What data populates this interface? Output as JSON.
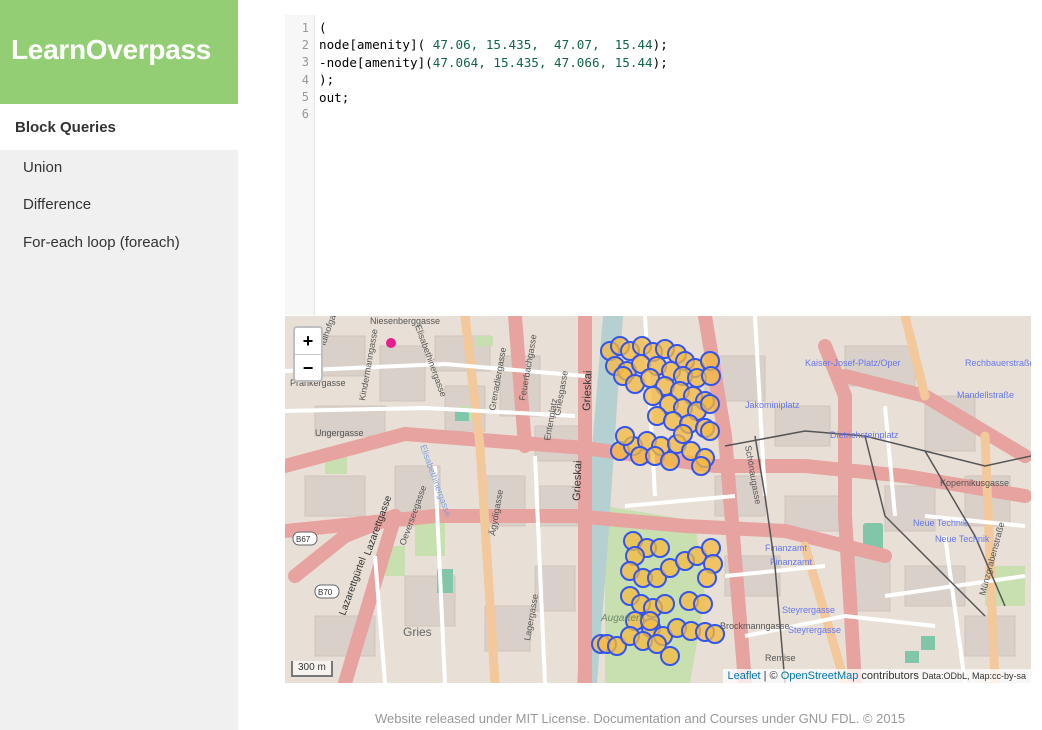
{
  "brand": {
    "title": "LearnOverpass"
  },
  "sidebar": {
    "section_title": "Block Queries",
    "items": [
      {
        "label": "Union"
      },
      {
        "label": "Difference"
      },
      {
        "label": "For-each loop (foreach)"
      }
    ]
  },
  "editor": {
    "line_numbers": [
      "1",
      "2",
      "3",
      "4",
      "5",
      "6"
    ],
    "lines": [
      {
        "a": "(",
        "n": "",
        "b": ""
      },
      {
        "a": "node[amenity](",
        "n": " 47.06, 15.435,  47.07,  15.44",
        "b": ");"
      },
      {
        "a": "-node[amenity](",
        "n": "47.064, 15.435, 47.066, 15.44",
        "b": ");"
      },
      {
        "a": ");",
        "n": "",
        "b": ""
      },
      {
        "a": "out;",
        "n": "",
        "b": ""
      },
      {
        "a": "",
        "n": "",
        "b": ""
      }
    ]
  },
  "map": {
    "zoom_in": "+",
    "zoom_out": "−",
    "scale": "300 m",
    "attribution": {
      "leaflet": "Leaflet",
      "sep": " | © ",
      "osm": "OpenStreetMap",
      "contributors": " contributors",
      "license": "Data:ODbL, Map:cc-by-sa"
    },
    "labels": {
      "niesenberg": "Niesenberggasse",
      "elisabethinergasse": "Elisabethinergasse",
      "prankergasse": "Prankergasse",
      "idlhofgasse": "Idlhofgasse",
      "kindermanngasse": "Kindermanngasse",
      "ungergasse": "Ungergasse",
      "grenadiergasse": "Grenadiergasse",
      "feuerbachgasse": "Feuerbachgasse",
      "griesgasse": "Griesgasse",
      "entenplatz": "Entenplatz",
      "grieskai": "Grieskai",
      "elisabethinergasse2": "Elisabethinergasse",
      "lazarettgasse": "Lazarettgasse",
      "lazarettgürtel": "Lazarettgürtel",
      "oeverseegasse": "Oeverseegasse",
      "agydigasse": "Ägydigasse",
      "lagergasse": "Lagergasse",
      "gries": "Gries",
      "augarten": "Augarten",
      "kaiserjosef": "Kaiser-Josef-Platz/Oper",
      "jakominiplatz": "Jakominiplatz",
      "dietrichsteinplatz": "Dietrichsteinplatz",
      "rechbauerstr": "Rechbauerstraße",
      "mandellstrasse": "Mandellstraße",
      "finanzamt": "Finanzamt",
      "finanzamt2": "Finanzamt",
      "neuetechnik": "Neue Technik",
      "neuetechnik2": "Neue Technik",
      "steyrergasse": "Steyrergasse",
      "steyrergasse2": "Steyrergasse",
      "schoenaugasse": "Schönaugasse",
      "kopernikusgasse": "Kopernikusgasse",
      "muenzgraben": "Münzgrabenstraße",
      "brockmanngasse": "Brockmanngasse",
      "remise": "Remise",
      "b67": "B67",
      "b70": "B70"
    }
  },
  "colors": {
    "brand": "#93cd74",
    "sidebar": "#f0f0f0",
    "marker_stroke": "#3355ee",
    "marker_fill": "#f5b93e"
  },
  "footer": {
    "text": "Website released under MIT License. Documentation and Courses under GNU FDL. © 2015"
  }
}
